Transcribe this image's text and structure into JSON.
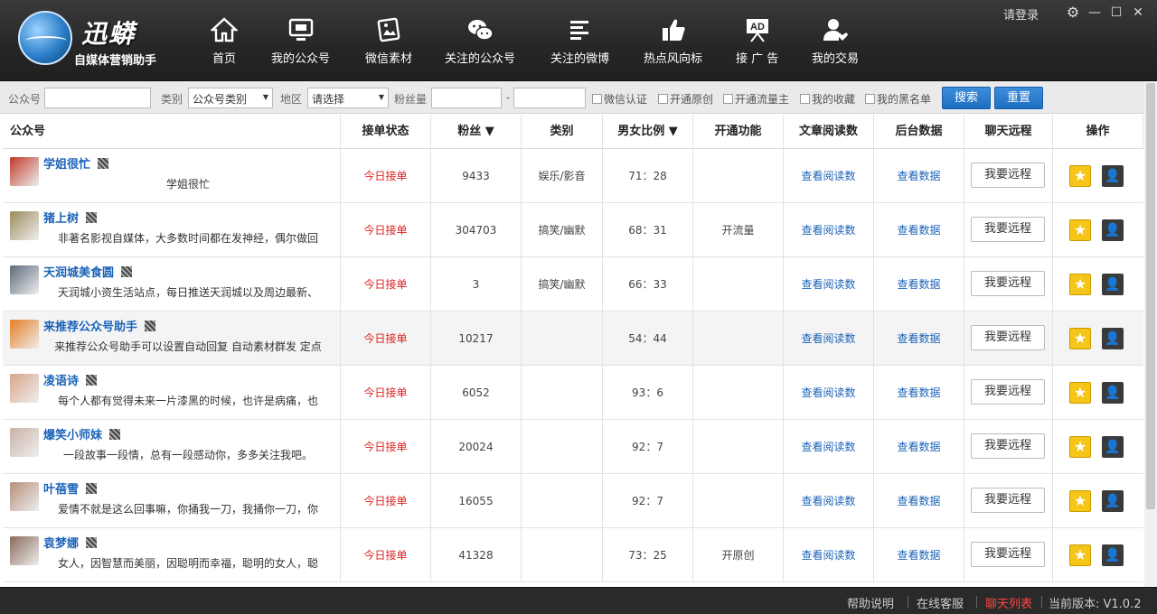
{
  "brand": {
    "name": "迅蟒",
    "slogan": "自媒体营销助手"
  },
  "nav": [
    {
      "label": "首页",
      "icon": "home-icon"
    },
    {
      "label": "我的公众号",
      "icon": "monitor-icon"
    },
    {
      "label": "微信素材",
      "icon": "image-icon"
    },
    {
      "label": "关注的公众号",
      "icon": "wechat-icon"
    },
    {
      "label": "关注的微博",
      "icon": "list-icon"
    },
    {
      "label": "热点风向标",
      "icon": "thumbs-up-icon"
    },
    {
      "label": "接 广 告",
      "icon": "ad-icon",
      "icon_text": "AD"
    },
    {
      "label": "我的交易",
      "icon": "user-heart-icon"
    }
  ],
  "window": {
    "login_label": "请登录",
    "settings": "gear-icon",
    "minimize": "minimize-icon",
    "maximize": "maximize-icon",
    "close": "close-icon"
  },
  "filter": {
    "account_label": "公众号",
    "account_value": "",
    "category_label": "类别",
    "category_value": "公众号类别",
    "region_label": "地区",
    "region_value": "请选择",
    "fans_label": "粉丝量",
    "fans_min": "",
    "fans_sep": "-",
    "fans_max": "",
    "checks": [
      "微信认证",
      "开通原创",
      "开通流量主",
      "我的收藏",
      "我的黑名单"
    ],
    "search_label": "搜索",
    "reset_label": "重置"
  },
  "table": {
    "headers": [
      "公众号",
      "接单状态",
      "粉丝 ▼",
      "类别",
      "男女比例 ▼",
      "开通功能",
      "文章阅读数",
      "后台数据",
      "聊天远程",
      "操作"
    ],
    "rows": [
      {
        "name": "学姐很忙",
        "desc": "学姐很忙",
        "status": "今日接单",
        "fans": "9433",
        "category": "娱乐/影音",
        "ratio": "71：28",
        "feature": "",
        "reads": "查看阅读数",
        "backend": "查看数据",
        "remote": "我要远程",
        "avatar_color": "#c0392b"
      },
      {
        "name": "猪上树",
        "desc": "非著名影视自媒体，大多数时间都在发神经，偶尔做回",
        "status": "今日接单",
        "fans": "304703",
        "category": "搞笑/幽默",
        "ratio": "68：31",
        "feature": "开流量",
        "reads": "查看阅读数",
        "backend": "查看数据",
        "remote": "我要远程",
        "avatar_color": "#9b8b5a"
      },
      {
        "name": "天润城美食圆",
        "desc": "天润城小资生活站点，每日推送天润城以及周边最新、",
        "status": "今日接单",
        "fans": "3",
        "category": "搞笑/幽默",
        "ratio": "66：33",
        "feature": "",
        "reads": "查看阅读数",
        "backend": "查看数据",
        "remote": "我要远程",
        "avatar_color": "#5a6b7a"
      },
      {
        "name": "来推荐公众号助手",
        "desc": "来推荐公众号助手可以设置自动回复 自动素材群发 定点",
        "status": "今日接单",
        "fans": "10217",
        "category": "",
        "ratio": "54：44",
        "feature": "",
        "reads": "查看阅读数",
        "backend": "查看数据",
        "remote": "我要远程",
        "avatar_color": "#e67e22"
      },
      {
        "name": "凌语诗",
        "desc": "每个人都有觉得未来一片漆黑的时候，也许是病痛，也",
        "status": "今日接单",
        "fans": "6052",
        "category": "",
        "ratio": "93：6",
        "feature": "",
        "reads": "查看阅读数",
        "backend": "查看数据",
        "remote": "我要远程",
        "avatar_color": "#d9a58a"
      },
      {
        "name": "爆笑小师妹",
        "desc": "一段故事一段情，总有一段感动你，多多关注我吧。",
        "status": "今日接单",
        "fans": "20024",
        "category": "",
        "ratio": "92：7",
        "feature": "",
        "reads": "查看阅读数",
        "backend": "查看数据",
        "remote": "我要远程",
        "avatar_color": "#c9b2a6"
      },
      {
        "name": "叶蓓雪",
        "desc": "爱情不就是这么回事嘛，你捅我一刀，我捅你一刀，你",
        "status": "今日接单",
        "fans": "16055",
        "category": "",
        "ratio": "92：7",
        "feature": "",
        "reads": "查看阅读数",
        "backend": "查看数据",
        "remote": "我要远程",
        "avatar_color": "#b58f7a"
      },
      {
        "name": "袁梦娜",
        "desc": "女人，因智慧而美丽，因聪明而幸福，聪明的女人，聪",
        "status": "今日接单",
        "fans": "41328",
        "category": "",
        "ratio": "73：25",
        "feature": "开原创",
        "reads": "查看阅读数",
        "backend": "查看数据",
        "remote": "我要远程",
        "avatar_color": "#8a6a5a"
      }
    ]
  },
  "statusbar": {
    "help": "帮助说明",
    "service": "在线客服",
    "chat": "聊天列表",
    "version": "当前版本: V1.0.2"
  }
}
